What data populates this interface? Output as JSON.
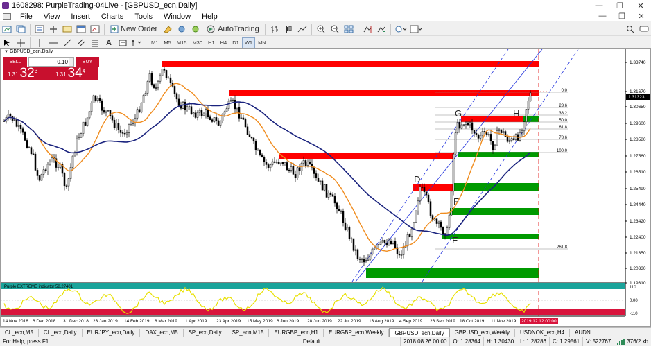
{
  "window": {
    "title": "1608298: PurpleTrading-04Live - [GBPUSD_ecn,Daily]",
    "controls": [
      "—",
      "❐",
      "✕"
    ]
  },
  "menu": {
    "items": [
      "File",
      "View",
      "Insert",
      "Charts",
      "Tools",
      "Window",
      "Help"
    ],
    "right_controls": [
      "—",
      "❐",
      "✕"
    ]
  },
  "toolbar": {
    "new_order_label": "New Order",
    "autotrading_label": "AutoTrading",
    "timeframes": [
      "M1",
      "M5",
      "M15",
      "M30",
      "H1",
      "H4",
      "D1",
      "W1",
      "MN"
    ],
    "active_timeframe": "W1"
  },
  "chart": {
    "symbol_label": "GBPUSD_ecn,Daily",
    "current_price": "1.31323",
    "current_time_label": "2019.12.12 00:00",
    "accent_up": "#00a000",
    "accent_down": "#e00000"
  },
  "trade_panel": {
    "sell_label": "SELL",
    "buy_label": "BUY",
    "lots": "0.10",
    "sell_price_prefix": "1.31",
    "sell_price_big": "32",
    "sell_price_pip": "3",
    "buy_price_prefix": "1.31",
    "buy_price_big": "34",
    "buy_price_pip": "4"
  },
  "price_axis": [
    "1.33740",
    "1.31670",
    "1.30650",
    "1.29600",
    "1.28580",
    "1.27560",
    "1.26510",
    "1.25490",
    "1.24440",
    "1.23420",
    "1.22400",
    "1.21350",
    "1.20330",
    "1.19310"
  ],
  "time_axis": [
    "14 Nov 2018",
    "6 Dec 2018",
    "31 Dec 2018",
    "23 Jan 2019",
    "14 Feb 2019",
    "8 Mar 2019",
    "1 Apr 2019",
    "23 Apr 2019",
    "15 May 2019",
    "6 Jun 2019",
    "28 Jun 2019",
    "22 Jul 2019",
    "13 Aug 2019",
    "4 Sep 2019",
    "26 Sep 2019",
    "18 Oct 2019",
    "11 Nov 2019"
  ],
  "fibonacci": [
    "0.0",
    "23.6",
    "38.2",
    "50.0",
    "61.8",
    "78.6",
    "100.0",
    "261.8"
  ],
  "pattern_labels": [
    "G",
    "H",
    "D",
    "F",
    "E"
  ],
  "indicator": {
    "name": "Purple EXTREME indicator 58.27401",
    "levels": [
      "110",
      "0.00",
      "-110"
    ]
  },
  "tabs": [
    "CL_ecn,M5",
    "CL_ecn,Daily",
    "EURJPY_ecn,Daily",
    "DAX_ecn,M5",
    "SP_ecn,Daily",
    "SP_ecn,M15",
    "EURGBP_ecn,H1",
    "EURGBP_ecn,Weekly",
    "GBPUSD_ecn,Daily",
    "GBPUSD_ecn,Weekly",
    "USDNOK_ecn,H4",
    "AUDN"
  ],
  "active_tab": "GBPUSD_ecn,Daily",
  "status": {
    "help": "For Help, press F1",
    "profile": "Default",
    "datetime": "2018.08.26 00:00",
    "open": "O: 1.28364",
    "high": "H: 1.30430",
    "low": "L: 1.28286",
    "close": "C: 1.29561",
    "volume": "V: 522767",
    "traffic": "376/2 kb"
  }
}
